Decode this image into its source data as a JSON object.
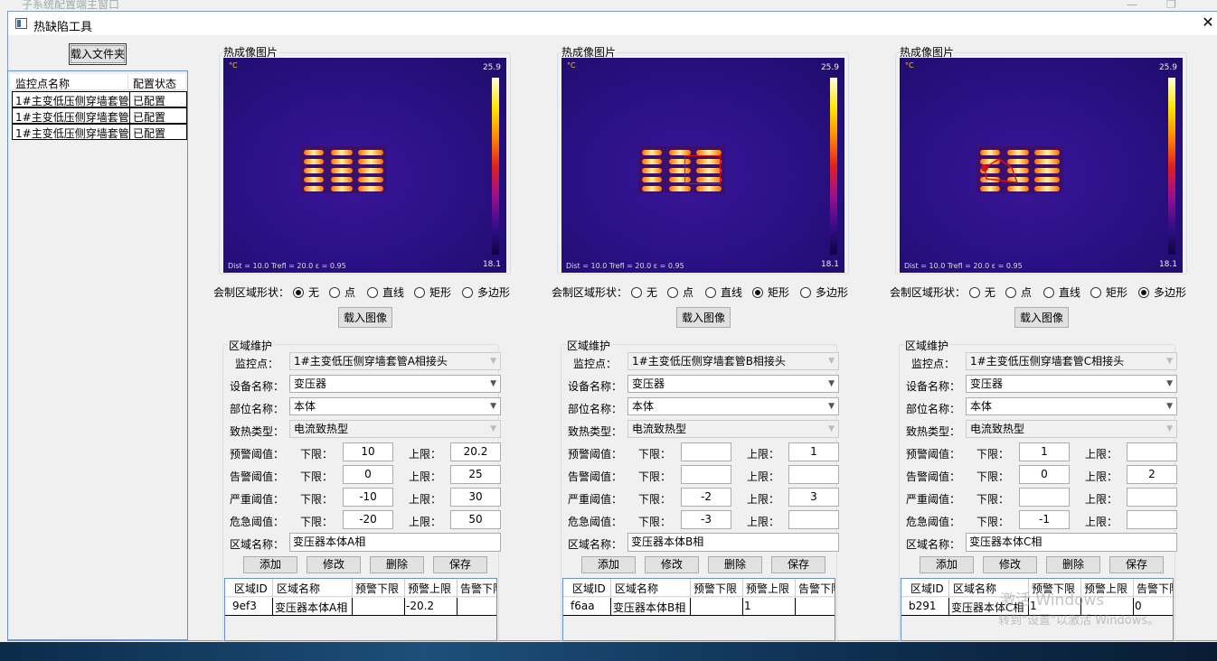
{
  "background_window": {
    "title": "子系统配置端主窗口"
  },
  "window": {
    "title": "热缺陷工具"
  },
  "load_folder_label": "载入文件夹",
  "monitor_list": {
    "headers": [
      "监控点名称",
      "配置状态"
    ],
    "rows": [
      {
        "name": "1#主变低压侧穿墙套管",
        "status": "已配置"
      },
      {
        "name": "1#主变低压侧穿墙套管",
        "status": "已配置"
      },
      {
        "name": "1#主变低压侧穿墙套管",
        "status": "已配置"
      }
    ]
  },
  "common": {
    "thermal_label": "热成像图片",
    "deg_unit": "°C",
    "temp_max": "25.9",
    "temp_min": "18.1",
    "image_info": "Dist = 10.0   Trefl = 20.0   ε = 0.95",
    "draw_label": "会制区域形状：",
    "shape_options": [
      "无",
      "点",
      "直线",
      "矩形",
      "多边形"
    ],
    "load_image_label": "载入图像",
    "area_group_label": "区域维护",
    "monitor_label": "监控点：",
    "device_label": "设备名称：",
    "part_label": "部位名称：",
    "cause_label": "致热类型：",
    "warn_label": "预警阈值：",
    "alarm_label": "告警阈值：",
    "severe_label": "严重阈值：",
    "critical_label": "危急阈值：",
    "lower_label": "下限：",
    "upper_label": "上限：",
    "area_name_label": "区域名称：",
    "add_label": "添加",
    "modify_label": "修改",
    "delete_label": "删除",
    "save_label": "保存",
    "grid_headers": [
      "区域ID",
      "区域名称",
      "预警下限",
      "预警上限",
      "告警下限"
    ]
  },
  "panels": [
    {
      "selected_shape": 0,
      "monitor": "1#主变低压侧穿墙套管A相接头",
      "device": "变压器",
      "part": "本体",
      "cause": "电流致热型",
      "warn_lower": "10",
      "warn_upper": "20.2",
      "alarm_lower": "0",
      "alarm_upper": "25",
      "severe_lower": "-10",
      "severe_upper": "30",
      "critical_lower": "-20",
      "critical_upper": "50",
      "area_name": "变压器本体A相",
      "grid_row": [
        "9ef3",
        "变压器本体A相",
        "",
        "-20.2",
        ""
      ]
    },
    {
      "selected_shape": 3,
      "monitor": "1#主变低压侧穿墙套管B相接头",
      "device": "变压器",
      "part": "本体",
      "cause": "电流致热型",
      "warn_lower": "",
      "warn_upper": "1",
      "alarm_lower": "",
      "alarm_upper": "",
      "severe_lower": "-2",
      "severe_upper": "3",
      "critical_lower": "-3",
      "critical_upper": "",
      "area_name": "变压器本体B相",
      "grid_row": [
        "f6aa",
        "变压器本体B相",
        "",
        "1",
        ""
      ]
    },
    {
      "selected_shape": 4,
      "monitor": "1#主变低压侧穿墙套管C相接头",
      "device": "变压器",
      "part": "本体",
      "cause": "电流致热型",
      "warn_lower": "1",
      "warn_upper": "",
      "alarm_lower": "0",
      "alarm_upper": "2",
      "severe_lower": "",
      "severe_upper": "",
      "critical_lower": "-1",
      "critical_upper": "",
      "area_name": "变压器本体C相",
      "grid_row": [
        "b291",
        "变压器本体C相",
        "1",
        "",
        "0"
      ]
    }
  ],
  "watermark": {
    "line1": "激活 Windows",
    "line2": "转到\"设置\"以激活 Windows。"
  }
}
